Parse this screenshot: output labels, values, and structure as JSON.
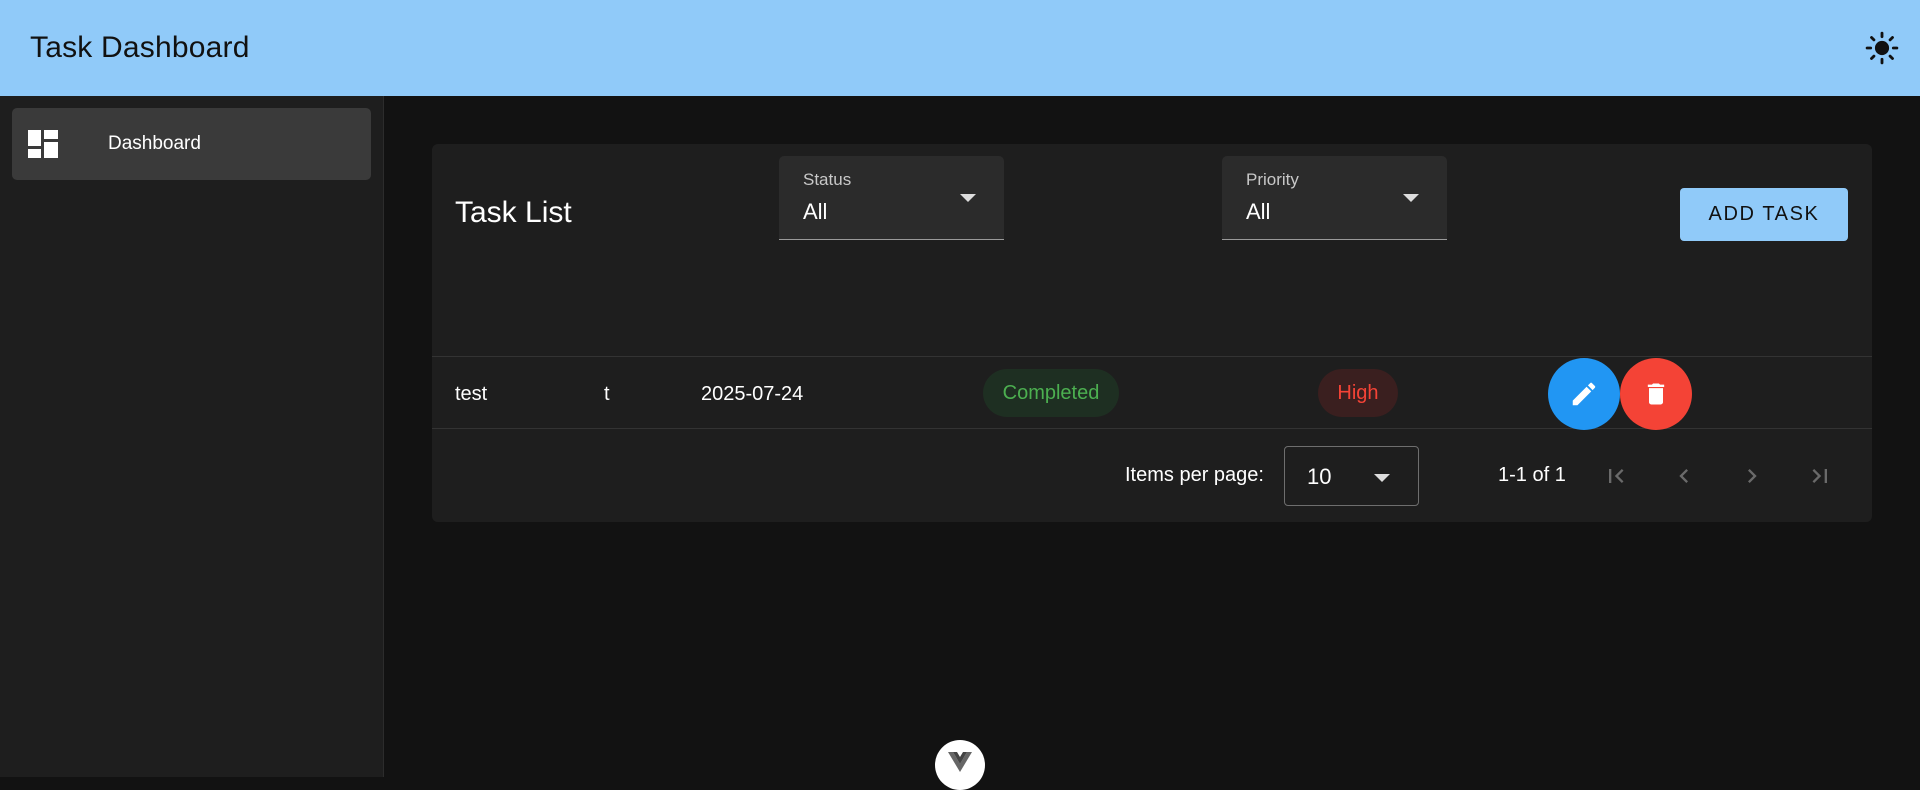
{
  "app_bar": {
    "title": "Task Dashboard",
    "theme_icon": "sun-icon",
    "color": "#90caf9"
  },
  "sidebar": {
    "items": [
      {
        "label": "Dashboard",
        "icon": "dashboard-icon"
      }
    ]
  },
  "task_list": {
    "title": "Task List",
    "filters": {
      "status": {
        "label": "Status",
        "value": "All"
      },
      "priority": {
        "label": "Priority",
        "value": "All"
      }
    },
    "add_label": "ADD TASK",
    "rows": [
      {
        "title": "test",
        "description": "t",
        "due_date": "2025-07-24",
        "status": "Completed",
        "priority": "High"
      }
    ],
    "pagination": {
      "items_per_page_label": "Items per page:",
      "items_per_page": "10",
      "range": "1-1 of 1"
    }
  },
  "colors": {
    "accent": "#90caf9",
    "status_completed": "#4caf50",
    "priority_high": "#f44336",
    "edit": "#2196f3",
    "delete": "#f44336"
  }
}
